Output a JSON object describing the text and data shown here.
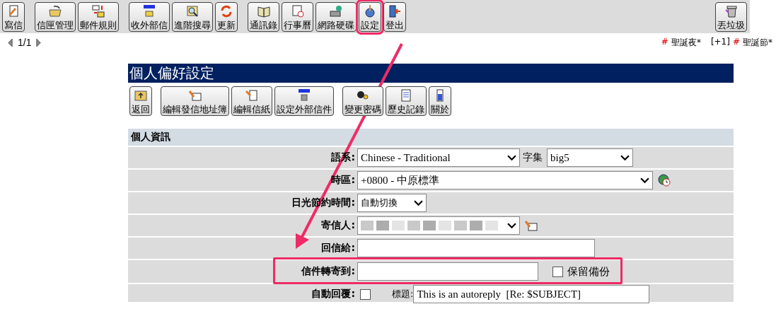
{
  "toolbar": {
    "groups": [
      [
        {
          "label": "寫信",
          "kind": "compose",
          "highlighted": false
        }
      ],
      [
        {
          "label": "信匣管理",
          "kind": "folder",
          "highlighted": false
        },
        {
          "label": "郵件規則",
          "kind": "rules",
          "highlighted": false
        }
      ],
      [
        {
          "label": "收外部信",
          "kind": "pop3",
          "highlighted": false
        },
        {
          "label": "進階搜尋",
          "kind": "search",
          "highlighted": false
        },
        {
          "label": "更新",
          "kind": "refresh",
          "highlighted": false
        }
      ],
      [
        {
          "label": "通訊錄",
          "kind": "book",
          "highlighted": false
        },
        {
          "label": "行事曆",
          "kind": "calendar",
          "highlighted": false
        },
        {
          "label": "網路硬碟",
          "kind": "drive",
          "highlighted": false
        },
        {
          "label": "設定",
          "kind": "settings",
          "highlighted": true
        },
        {
          "label": "登出",
          "kind": "logout",
          "highlighted": false
        }
      ]
    ],
    "right": {
      "label": "丟垃圾",
      "kind": "trash",
      "highlighted": false
    }
  },
  "pager": {
    "text": "1/1"
  },
  "holidays": [
    {
      "mark": "#",
      "name": "聖誕夜*"
    },
    {
      "prefix": "[+1]",
      "mark": "#",
      "name": "聖誕節*"
    }
  ],
  "panel": {
    "title": "個人偏好設定",
    "buttons": [
      [
        {
          "label": "返回",
          "kind": "back"
        }
      ],
      [
        {
          "label": "編輯發信地址簿",
          "kind": "address"
        },
        {
          "label": "編輯信紙",
          "kind": "stationery"
        },
        {
          "label": "設定外部信件",
          "kind": "pop3"
        }
      ],
      [
        {
          "label": "變更密碼",
          "kind": "password"
        },
        {
          "label": "歷史記錄",
          "kind": "history"
        },
        {
          "label": "關於",
          "kind": "about"
        }
      ]
    ],
    "section": "個人資訊",
    "rows": [
      {
        "kind": "language",
        "label": "語系:",
        "value": "Chinese - Traditional",
        "extra_label": "字集",
        "extra_value": "big5",
        "highlighted": false
      },
      {
        "kind": "timezone",
        "label": "時區:",
        "value": "+0800 - 中原標準",
        "highlighted": false
      },
      {
        "kind": "dst",
        "label": "日光節約時間:",
        "value": "自動切換",
        "highlighted": false
      },
      {
        "kind": "sender",
        "label": "寄信人:",
        "highlighted": false
      },
      {
        "kind": "reply",
        "label": "回信給:",
        "highlighted": false
      },
      {
        "kind": "forward",
        "label": "信件轉寄到:",
        "check_label": "保留備份",
        "checked": false,
        "highlighted": true
      },
      {
        "kind": "autoreply",
        "label": "自動回覆:",
        "checked": false,
        "subject_label": "標題:",
        "value": "This is an autoreply  [Re: $SUBJECT]",
        "highlighted": false
      }
    ]
  }
}
